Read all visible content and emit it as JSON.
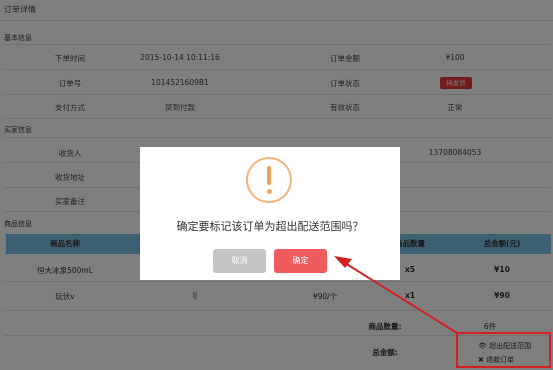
{
  "page_title": "订单详情",
  "basic_info": {
    "section_label": "基本信息",
    "rows": [
      {
        "label1": "下单时间",
        "value1": "2015-10-14 10:11:16",
        "label2": "订单金额",
        "value2": "¥100"
      },
      {
        "label1": "订单号",
        "value1": "1014521609B1",
        "label2": "订单状态",
        "value2": "待发货"
      },
      {
        "label1": "支付方式",
        "value1": "货到付款",
        "label2": "有效状态",
        "value2": "正常"
      }
    ]
  },
  "buyer_info": {
    "section_label": "买家信息",
    "rows": [
      {
        "label": "收货人",
        "value": "",
        "phone": "13708084053"
      },
      {
        "label": "收货地址",
        "value": ""
      },
      {
        "label": "买家备注",
        "value": ""
      }
    ]
  },
  "goods_info": {
    "section_label": "商品信息",
    "columns": [
      "商品名称",
      "",
      "",
      "商品数量",
      "总金额(元)"
    ],
    "rows": [
      {
        "name": "恒大冰泉500mL",
        "spec": "",
        "price": "",
        "qty": "x5",
        "total": "¥10"
      },
      {
        "name": "玩伏v",
        "spec": "lj",
        "price": "¥90/个",
        "qty": "x1",
        "total": "¥90"
      }
    ],
    "summary_qty_label": "商品数量:",
    "summary_qty_value": "6件",
    "summary_total_label": "总金额:"
  },
  "actions": {
    "mark_out_of_range": "超出配送范围",
    "refund_order": "退款订单"
  },
  "dialog": {
    "message": "确定要标记该订单为超出配送范围吗？",
    "cancel_label": "取消",
    "confirm_label": "确定"
  }
}
